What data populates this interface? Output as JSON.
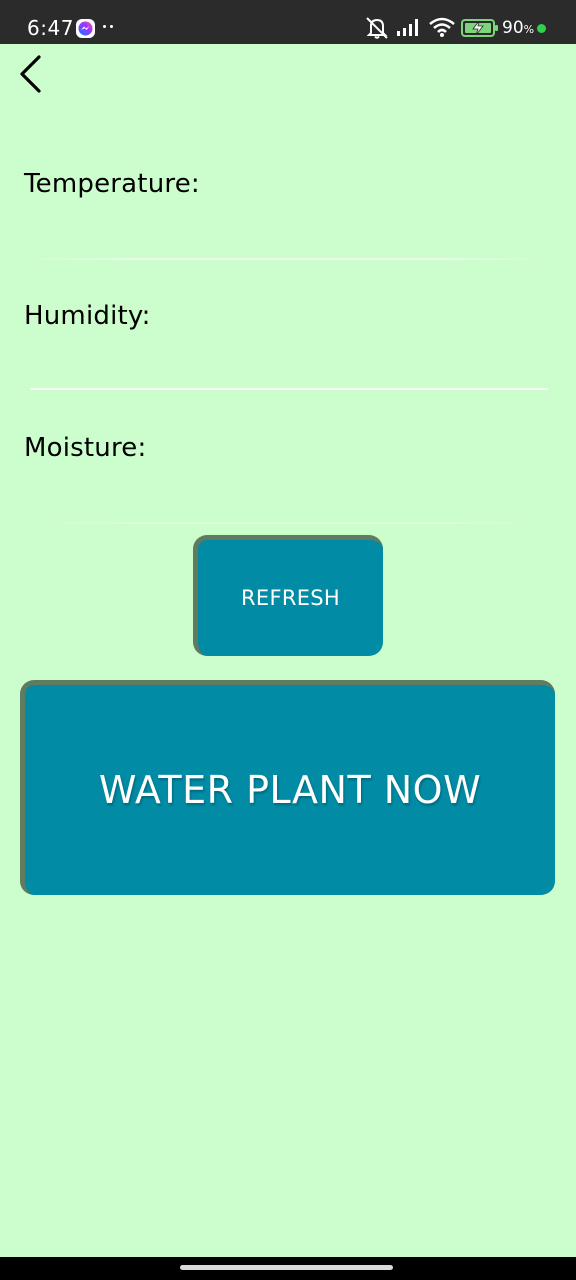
{
  "status_bar": {
    "time": "6:47",
    "battery_percent": "90",
    "battery_unit": "%",
    "icons": [
      "messenger-icon",
      "more-dots-icon",
      "mute-icon",
      "signal-icon",
      "wifi-icon",
      "battery-charging-icon",
      "active-dot-icon"
    ]
  },
  "navigation": {
    "back_icon": "chevron-left-icon"
  },
  "sensors": {
    "temperature_label": "Temperature:",
    "temperature_value": "",
    "humidity_label": "Humidity:",
    "humidity_value": "",
    "moisture_label": "Moisture:",
    "moisture_value": ""
  },
  "actions": {
    "refresh_label": "REFRESH",
    "water_label": "WATER PLANT NOW"
  },
  "colors": {
    "background": "#ccfdcc",
    "button": "#018ba4",
    "button_border": "#5f7c61",
    "status_bar": "#2b2b2b"
  }
}
